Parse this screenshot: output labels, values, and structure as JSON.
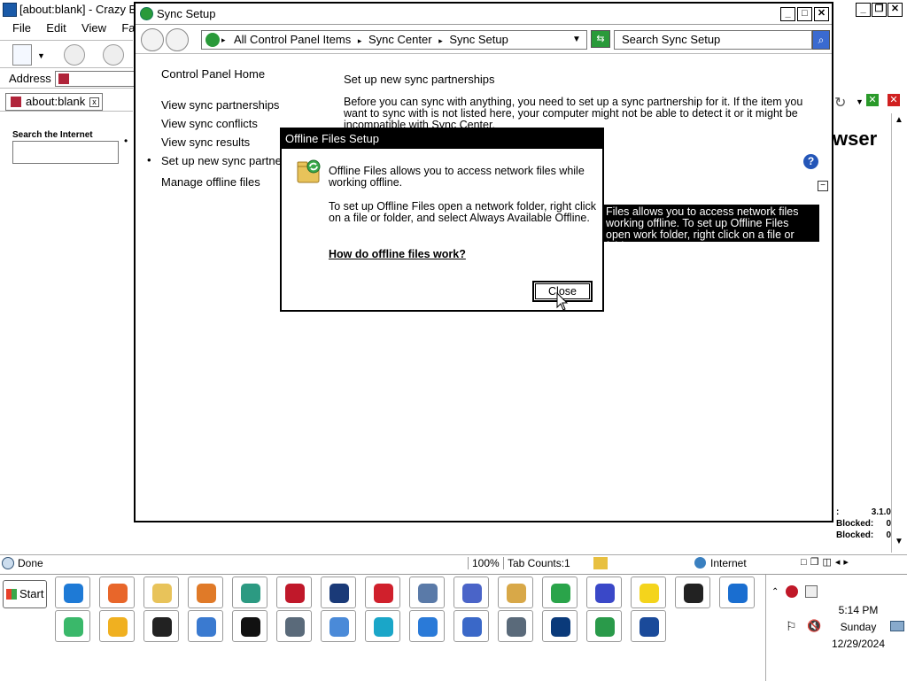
{
  "browser": {
    "title": "[about:blank] - Crazy B",
    "menu": [
      "File",
      "Edit",
      "View",
      "Favor"
    ],
    "address_label": "Address",
    "tab_label": "about:blank",
    "search_label": "Search the Internet",
    "heading_fragment": "wser",
    "status_text": "Done",
    "status_zoom": "100%",
    "status_tabs": "Tab Counts:1",
    "status_zone": "Internet",
    "stats": {
      "version": "3.1.0",
      "line1_label": "Blocked:",
      "line1_value": "0",
      "line2_label": "Blocked:",
      "line2_value": "0"
    }
  },
  "sync_window": {
    "title": "Sync Setup",
    "breadcrumb": [
      "All Control Panel Items",
      "Sync Center",
      "Sync Setup"
    ],
    "search_placeholder": "Search Sync Setup",
    "sidebar": {
      "home": "Control Panel Home",
      "items": [
        "View sync partnerships",
        "View sync conflicts",
        "View sync results",
        "Set up new sync partne",
        "Manage offline files"
      ]
    },
    "main_heading": "Set up new sync partnerships",
    "main_body": "Before you can sync with anything, you need to set up a sync partnership for it. If the item you want to sync with is not listed here, your computer might not be able to detect it or it might be incompatible with Sync Center.",
    "selected_item_text": "Files allows you to access network files working offline. To set up Offline Files open work folder, right click on a file or folder, a..."
  },
  "dialog": {
    "title": "Offline Files Setup",
    "para1": "Offline Files allows you to access network files while working offline.",
    "para2": "To set up Offline Files open a network folder, right click on a file or folder, and select Always Available Offline.",
    "link": "How do offline files work?",
    "close_label": "Close"
  },
  "taskbar": {
    "start_label": "Start",
    "icons_row1": [
      {
        "name": "internet-explorer-icon",
        "color": "#1e7ad6"
      },
      {
        "name": "firefox-icon",
        "color": "#e8662a"
      },
      {
        "name": "file-explorer-icon",
        "color": "#e8c35a"
      },
      {
        "name": "media-player-icon",
        "color": "#e07a28"
      },
      {
        "name": "green-orb-icon",
        "color": "#2c9a82"
      },
      {
        "name": "red-gear-icon",
        "color": "#c0182a"
      },
      {
        "name": "security-shield-icon",
        "color": "#1a3a78"
      },
      {
        "name": "video-camera-icon",
        "color": "#d0202c"
      },
      {
        "name": "control-panel-icon",
        "color": "#5a7aa8"
      },
      {
        "name": "bird-icon",
        "color": "#4a64c8"
      },
      {
        "name": "paint-palette-icon",
        "color": "#d8a848"
      },
      {
        "name": "chrome-icon",
        "color": "#2aa44a"
      },
      {
        "name": "infinity-icon",
        "color": "#3a48c8"
      },
      {
        "name": "best-buy-icon",
        "color": "#f4d41c"
      },
      {
        "name": "blackberry-icon",
        "color": "#222222"
      },
      {
        "name": "edge-legacy-icon",
        "color": "#1a6ed0"
      }
    ],
    "icons_row2": [
      {
        "name": "green-cube-icon",
        "color": "#3ab86a"
      },
      {
        "name": "slides-icon",
        "color": "#f0b020"
      },
      {
        "name": "tiles-icon",
        "color": "#222222"
      },
      {
        "name": "document-icon",
        "color": "#3a7ad0"
      },
      {
        "name": "terminal-icon",
        "color": "#111111"
      },
      {
        "name": "reader-icon",
        "color": "#5a6a7a"
      },
      {
        "name": "paper-plane-icon",
        "color": "#4a8ad8"
      },
      {
        "name": "recycle-bin-icon",
        "color": "#1aa6c8"
      },
      {
        "name": "browser-circle-icon",
        "color": "#2a7ad8"
      },
      {
        "name": "ad-blocker-icon",
        "color": "#3a68c8"
      },
      {
        "name": "reader2-icon",
        "color": "#5a6a7a"
      },
      {
        "name": "ccleaner-icon",
        "color": "#0a3a7a"
      },
      {
        "name": "green-g-icon",
        "color": "#2a9a4a"
      },
      {
        "name": "star-icon",
        "color": "#1a4a9a"
      }
    ],
    "clock": {
      "time": "5:14 PM",
      "day": "Sunday",
      "date": "12/29/2024"
    }
  }
}
